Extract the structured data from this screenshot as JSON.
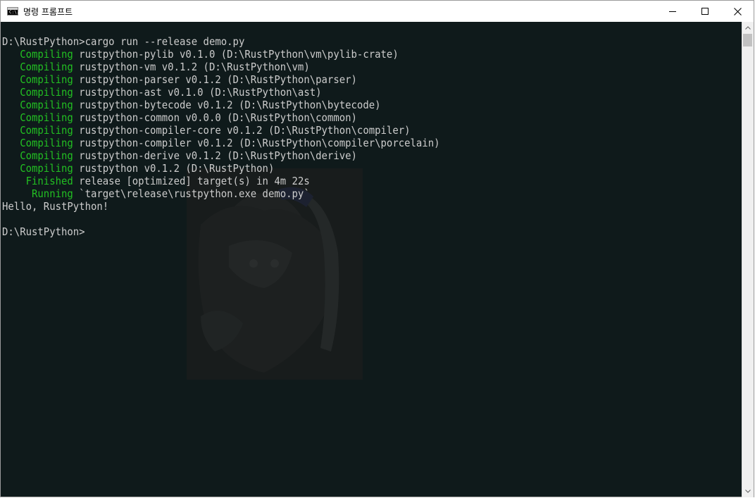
{
  "window": {
    "title": "명령 프롬프트",
    "icon_label": "C:\\."
  },
  "colors": {
    "console_bg": "#0f1a1b",
    "console_text": "#cccccc",
    "status_green": "#22c022"
  },
  "icons": {
    "minimize": "minimize-icon",
    "maximize": "maximize-icon",
    "close": "close-icon",
    "scroll_up": "scroll-up-arrow-icon",
    "scroll_down": "scroll-down-arrow-icon"
  },
  "console": {
    "lines": [
      {
        "status": "",
        "text": "D:\\RustPython>cargo run --release demo.py"
      },
      {
        "status": "   Compiling",
        "text": " rustpython-pylib v0.1.0 (D:\\RustPython\\vm\\pylib-crate)"
      },
      {
        "status": "   Compiling",
        "text": " rustpython-vm v0.1.2 (D:\\RustPython\\vm)"
      },
      {
        "status": "   Compiling",
        "text": " rustpython-parser v0.1.2 (D:\\RustPython\\parser)"
      },
      {
        "status": "   Compiling",
        "text": " rustpython-ast v0.1.0 (D:\\RustPython\\ast)"
      },
      {
        "status": "   Compiling",
        "text": " rustpython-bytecode v0.1.2 (D:\\RustPython\\bytecode)"
      },
      {
        "status": "   Compiling",
        "text": " rustpython-common v0.0.0 (D:\\RustPython\\common)"
      },
      {
        "status": "   Compiling",
        "text": " rustpython-compiler-core v0.1.2 (D:\\RustPython\\compiler)"
      },
      {
        "status": "   Compiling",
        "text": " rustpython-compiler v0.1.2 (D:\\RustPython\\compiler\\porcelain)"
      },
      {
        "status": "   Compiling",
        "text": " rustpython-derive v0.1.2 (D:\\RustPython\\derive)"
      },
      {
        "status": "   Compiling",
        "text": " rustpython v0.1.2 (D:\\RustPython)"
      },
      {
        "status": "    Finished",
        "text": " release [optimized] target(s) in 4m 22s"
      },
      {
        "status": "     Running",
        "text": " `target\\release\\rustpython.exe demo.py`"
      },
      {
        "status": "",
        "text": "Hello, RustPython!"
      },
      {
        "status": "",
        "text": ""
      },
      {
        "status": "",
        "text": "D:\\RustPython>"
      }
    ]
  }
}
